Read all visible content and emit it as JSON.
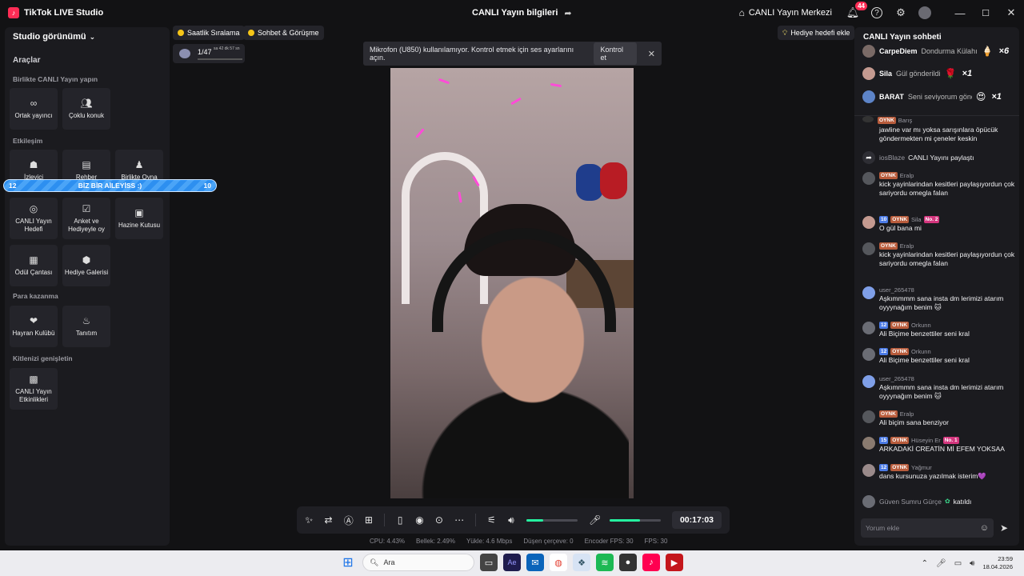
{
  "app": {
    "name": "TikTok LIVE Studio",
    "title": "CANLI Yayın bilgileri",
    "live_center": "CANLI Yayın Merkezi",
    "notif_count": "44"
  },
  "sidebar": {
    "studio_view": "Studio görünümü",
    "tools": "Araçlar",
    "sec_together": "Birlikte CANLI Yayın yapın",
    "sec_engage": "Etkileşim",
    "sec_earn": "Para kazanma",
    "sec_expand": "Kitlenizi genişletin",
    "tiles": {
      "cohost": "Ortak yayıncı",
      "multi": "Çoklu konuk",
      "viewer": "İzleyici",
      "guide": "Rehber",
      "play": "Birlikte Oyna",
      "goal": "CANLI Yayın Hedefi",
      "poll": "Anket ve Hediyeyle oy",
      "treasure": "Hazine Kutusu",
      "reward": "Ödül Çantası",
      "gallery": "Hediye Galerisi",
      "fanclub": "Hayran Kulübü",
      "promo": "Tanıtım",
      "events": "CANLI Yayın Etkinlikleri"
    }
  },
  "banner": {
    "left": "12",
    "text": "BİZ BİR AİLEYİSS :)",
    "right": "10",
    "fill_fraction": 1.0
  },
  "top": {
    "hourly": "Saatlik Sıralama",
    "chat_meet": "Sohbet & Görüşme",
    "rank": "1/47",
    "rank_time": "sa 42 dk 57 sn",
    "gift_goal": "Hediye hedefi ekle"
  },
  "notice": {
    "text": "Mikrofon (U850) kullanılamıyor. Kontrol etmek için ses ayarlarını açın.",
    "button": "Kontrol et"
  },
  "controls": {
    "timer": "00:17:03",
    "volume": 0.32,
    "mic": 0.6
  },
  "stats": {
    "cpu": "CPU: 4.43%",
    "mem": "Bellek: 2.49%",
    "upload": "Yükle: 4.6 Mbps",
    "dropped": "Düşen çerçeve: 0",
    "enc": "Encoder FPS: 30",
    "fps": "FPS: 30"
  },
  "chat": {
    "title": "CANLI Yayın sohbeti",
    "gifts": [
      {
        "user": "CarpeDiem",
        "text": "Dondurma Külahı",
        "mult": "×6"
      },
      {
        "user": "Sila",
        "text": "Gül gönderildi",
        "mult": "×1"
      },
      {
        "user": "BARAT",
        "text": "Seni seviyorum gönder",
        "mult": "×1"
      }
    ],
    "top_partial": {
      "badge": "OYNK",
      "user": "Barış"
    },
    "msgs": [
      {
        "user": "",
        "text": "jawline var mı yoksa sarışınlara öpücük göndermekten mi çeneler keskin"
      },
      {
        "user": "iosBlaze",
        "text": "CANLI Yayını paylaştı"
      },
      {
        "user": "Eralp",
        "badge": "OYNK",
        "text": "kick yayinlarindan kesitleri paylaşıyordun çok sariyordu omegla falan"
      },
      {
        "user": "Sila",
        "lvl": "10",
        "badge": "OYNK",
        "no": "No. 2",
        "text": "O gül bana mi"
      },
      {
        "user": "Eralp",
        "badge": "OYNK",
        "text": "kick yayinlarindan kesitleri paylaşıyordun çok sariyordu omegla falan"
      },
      {
        "user": "user_265478",
        "text": "Aşkımmmm sana insta dm lerimizi atarım oyyynağım benim 🐱"
      },
      {
        "user": "Orkunn",
        "lvl": "12",
        "badge": "OYNK",
        "text": "Ali Biçime benzettiler seni kral"
      },
      {
        "user": "Orkunn",
        "lvl": "12",
        "badge": "OYNK",
        "text": "Ali Biçime benzettiler seni kral"
      },
      {
        "user": "user_265478",
        "text": "Aşkımmmm sana insta dm lerimizi atarım oyyynağım benim 🐱"
      },
      {
        "user": "Eralp",
        "badge": "OYNK",
        "text": "Ali biçim sana benziyor"
      },
      {
        "user": "Hüseyin Er",
        "lvl": "15",
        "badge": "OYNK",
        "no": "No. 1",
        "text": "ARKADAKİ CREATİN Mİ EFEM YOKSAA"
      },
      {
        "user": "Yağmur",
        "lvl": "12",
        "badge": "OYNK",
        "text": "dans kursunuza yazılmak isterim💜"
      },
      {
        "user": "Güven Sumru Gürçe",
        "text": "katıldı"
      }
    ],
    "placeholder": "Yorum ekle"
  },
  "taskbar": {
    "search": "Ara",
    "time": "23:59",
    "date": "18.04.2026"
  }
}
